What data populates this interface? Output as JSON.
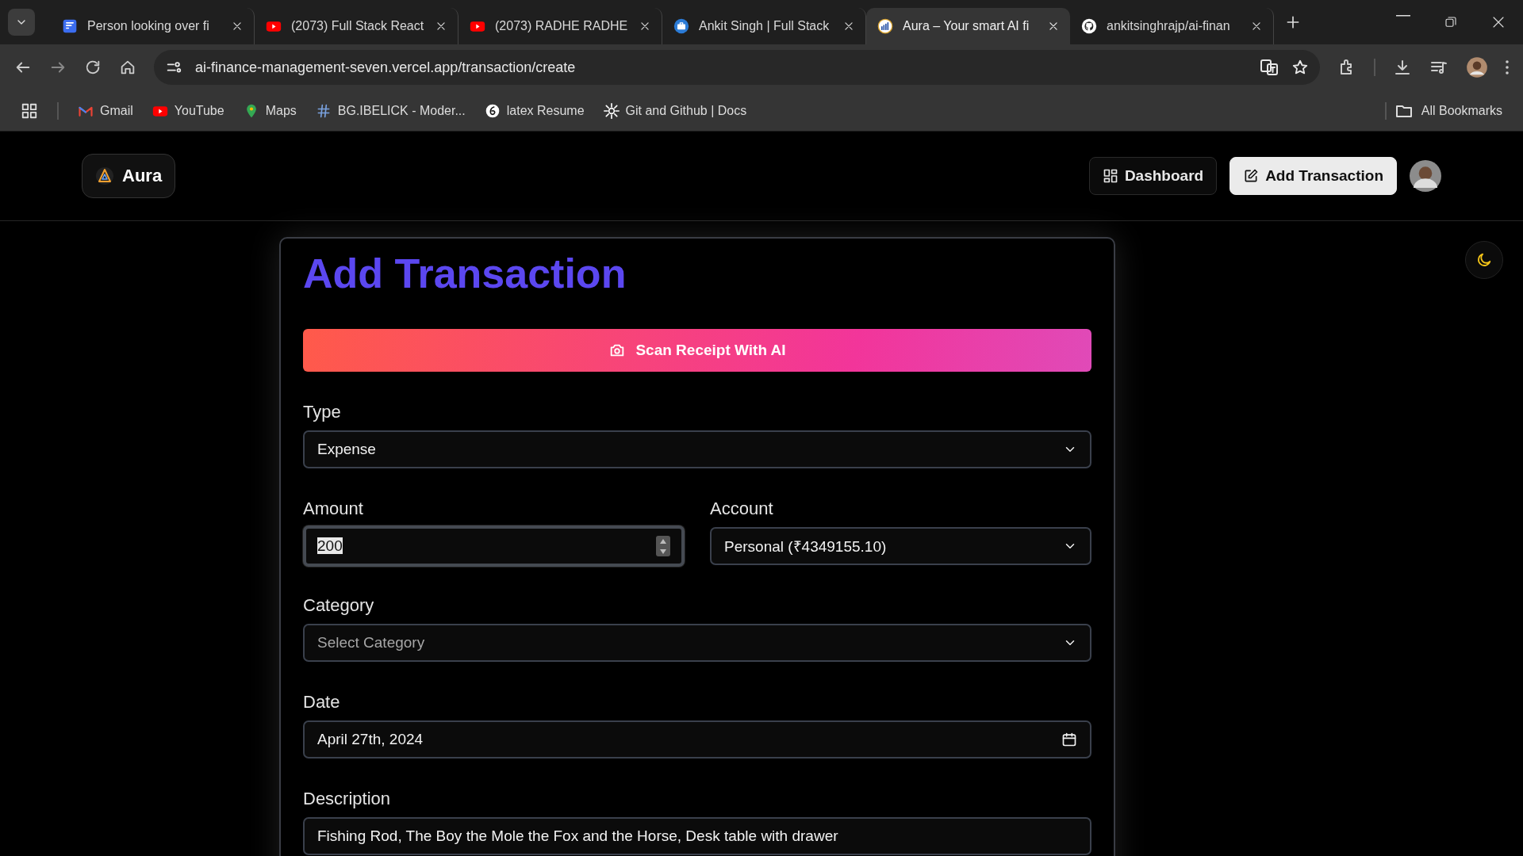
{
  "browser": {
    "tabs": [
      {
        "title": "Person looking over fi",
        "selected": false
      },
      {
        "title": "(2073) Full Stack React",
        "selected": false
      },
      {
        "title": "(2073) RADHE RADHE",
        "selected": false
      },
      {
        "title": "Ankit Singh | Full Stack",
        "selected": false
      },
      {
        "title": "Aura – Your smart AI fi",
        "selected": true
      },
      {
        "title": "ankitsinghrajp/ai-finan",
        "selected": false
      }
    ],
    "address": "ai-finance-management-seven.vercel.app/transaction/create",
    "bookmarks": [
      {
        "label": "Gmail"
      },
      {
        "label": "YouTube"
      },
      {
        "label": "Maps"
      },
      {
        "label": "BG.IBELICK - Moder..."
      },
      {
        "label": "latex Resume"
      },
      {
        "label": "Git and Github | Docs"
      }
    ],
    "all_bookmarks": "All Bookmarks"
  },
  "header": {
    "logo": "Aura",
    "nav": [
      {
        "label": "Dashboard",
        "kind": "outline"
      },
      {
        "label": "Add Transaction",
        "kind": "primary"
      }
    ]
  },
  "form": {
    "title": "Add Transaction",
    "scan_button": "Scan Receipt With AI",
    "rows": [
      [
        {
          "label": "Type",
          "kind": "select",
          "value": "Expense",
          "focused": false
        }
      ],
      [
        {
          "label": "Amount",
          "kind": "number",
          "value": "200",
          "focused": true
        },
        {
          "label": "Account",
          "kind": "select",
          "value": "Personal (₹4349155.10)",
          "focused": false
        }
      ],
      [
        {
          "label": "Category",
          "kind": "select",
          "placeholder": "Select Category",
          "focused": false
        }
      ],
      [
        {
          "label": "Date",
          "kind": "date",
          "value": "April 27th, 2024",
          "focused": false
        }
      ],
      [
        {
          "label": "Description",
          "kind": "text",
          "value": "Fishing Rod, The Boy the Mole the Fox and the Horse, Desk table with drawer",
          "focused": false
        }
      ]
    ]
  }
}
